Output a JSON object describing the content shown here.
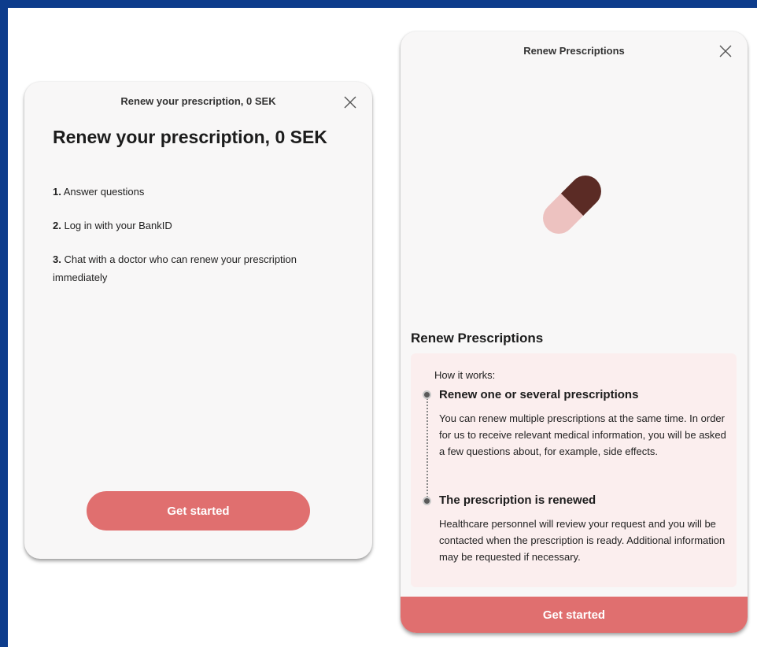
{
  "colors": {
    "frame": "#0d3c8c",
    "card": "#f8f7f7",
    "accent": "#e06f6f",
    "info_bg": "#fbeeee",
    "pill_dark": "#5b2b25",
    "pill_light": "#edc2c0"
  },
  "left_modal": {
    "header_title": "Renew your prescription, 0 SEK",
    "close_icon": "close-icon",
    "heading": "Renew your prescription, 0 SEK",
    "steps": [
      {
        "num": "1.",
        "text": "Answer questions"
      },
      {
        "num": "2.",
        "text": "Log in with your BankID"
      },
      {
        "num": "3.",
        "text": "Chat with a doctor who can renew your prescription immediately"
      }
    ],
    "cta": "Get started"
  },
  "right_modal": {
    "header_title": "Renew Prescriptions",
    "close_icon": "close-icon",
    "illustration": "pill-icon",
    "heading": "Renew Prescriptions",
    "intro": "How it works:",
    "items": [
      {
        "title": "Renew one or several prescriptions",
        "text": "You can renew multiple prescriptions at the same time. In order for us to receive relevant medical information, you will be asked a few questions about, for example, side effects."
      },
      {
        "title": "The prescription is renewed",
        "text": "Healthcare personnel will review your request and you will be contacted when the prescription is ready. Additional information may be requested if necessary."
      }
    ],
    "cta": "Get started"
  }
}
